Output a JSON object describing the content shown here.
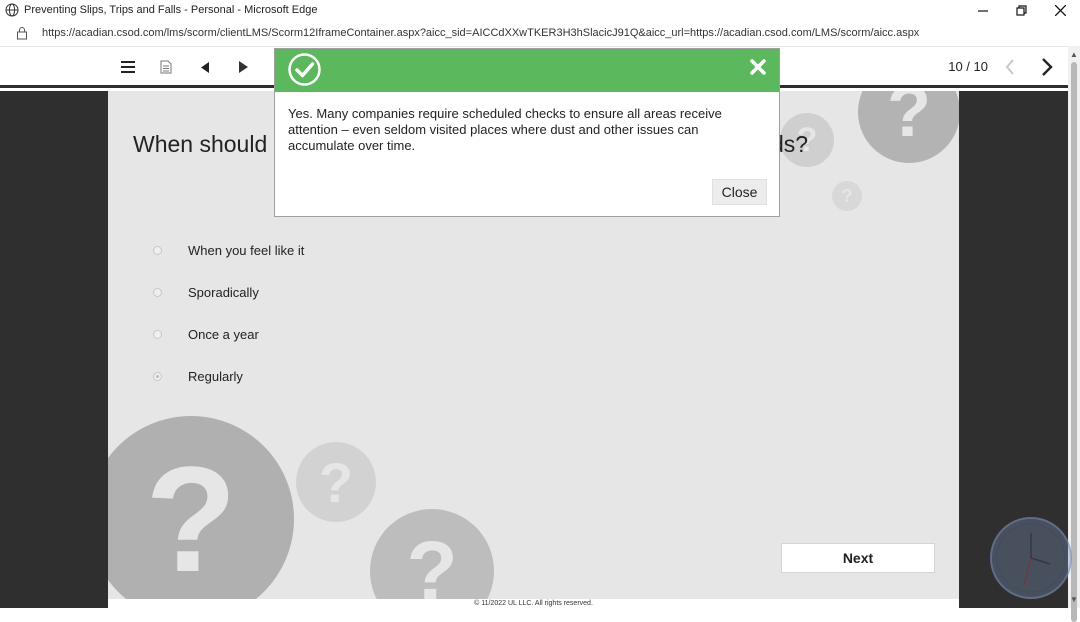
{
  "window": {
    "title": "Preventing Slips, Trips and Falls - Personal - Microsoft Edge",
    "minimize_icon": "minimize-icon",
    "restore_icon": "restore-icon",
    "close_icon": "close-icon"
  },
  "address_bar": {
    "url": "https://acadian.csod.com/lms/scorm/clientLMS/Scorm12IframeContainer.aspx?aicc_sid=AICCdXXwTKER3H3hSlacicJ91Q&aicc_url=https://acadian.csod.com/LMS/scorm/aicc.aspx"
  },
  "player_toolbar": {
    "menu_icon": "hamburger-menu-icon",
    "notes_icon": "document-icon",
    "prev_icon": "play-back-icon",
    "next_icon": "play-forward-icon",
    "page_count": "10 / 10",
    "page_prev_icon": "chevron-left-icon",
    "page_next_icon": "chevron-right-icon"
  },
  "slide": {
    "question_start": "When should",
    "question_end": "ds?",
    "options": [
      {
        "label": "When you feel like it",
        "selected": false
      },
      {
        "label": "Sporadically",
        "selected": false
      },
      {
        "label": "Once a year",
        "selected": false
      },
      {
        "label": "Regularly",
        "selected": true
      }
    ],
    "next_label": "Next",
    "footer": "© 11/2022 UL LLC. All rights reserved."
  },
  "feedback_modal": {
    "status_icon": "checkmark-circle-icon",
    "dismiss_icon": "close-x-icon",
    "message": "Yes. Many companies require scheduled checks to ensure all areas receive attention – even seldom visited places where dust and other issues can accumulate over time.",
    "close_label": "Close",
    "header_color": "#5cb85c"
  },
  "colors": {
    "slide_bg": "#e6e6e6",
    "stage_bg": "#2f2f2f",
    "question_mark_circle": "#b3b3b3"
  }
}
